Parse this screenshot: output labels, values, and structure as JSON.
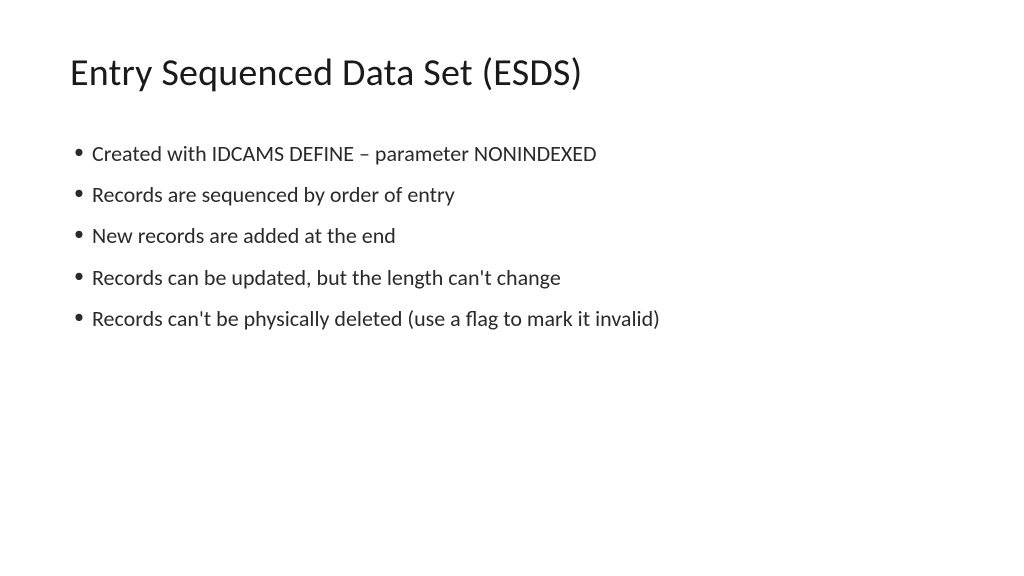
{
  "slide": {
    "title": "Entry Sequenced Data Set (ESDS)",
    "bullets": [
      "Created with IDCAMS DEFINE – parameter NONINDEXED",
      "Records are sequenced by order of entry",
      "New records are added at the end",
      "Records can be updated, but the length can't change",
      "Records can't be physically deleted (use a flag to mark it invalid)"
    ]
  }
}
